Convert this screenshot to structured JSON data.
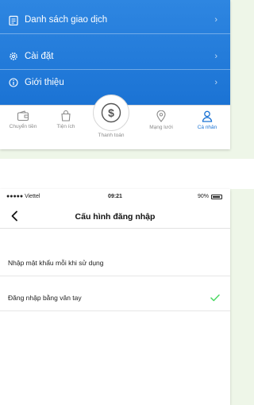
{
  "colors": {
    "primary": "#1b73d4",
    "check": "#4cd964",
    "backdrop": "#eef6e8"
  },
  "profile_screen": {
    "menu_items": [
      {
        "label": "Danh sách giao dịch",
        "icon": "clipboard-icon"
      },
      {
        "label": "Cài đặt",
        "icon": "gear-icon"
      },
      {
        "label": "Giới thiệu",
        "icon": "info-icon"
      }
    ],
    "tabs": [
      {
        "label": "Chuyển tiền",
        "icon": "wallet-icon"
      },
      {
        "label": "Tiện ích",
        "icon": "bag-icon"
      },
      {
        "label": "Thanh toán",
        "icon": "dollar-icon"
      },
      {
        "label": "Mạng lưới",
        "icon": "location-pin-icon"
      },
      {
        "label": "Cá nhân",
        "icon": "person-icon",
        "active": true
      }
    ]
  },
  "login_config_screen": {
    "status": {
      "carrier": "●●●●● Viettel",
      "time": "09:21",
      "battery": "90%"
    },
    "title": "Cấu hình đăng nhập",
    "options": [
      {
        "label": "Nhập mật khẩu mỗi khi sử dụng",
        "selected": false
      },
      {
        "label": "Đăng nhập bằng vân tay",
        "selected": true
      }
    ]
  }
}
